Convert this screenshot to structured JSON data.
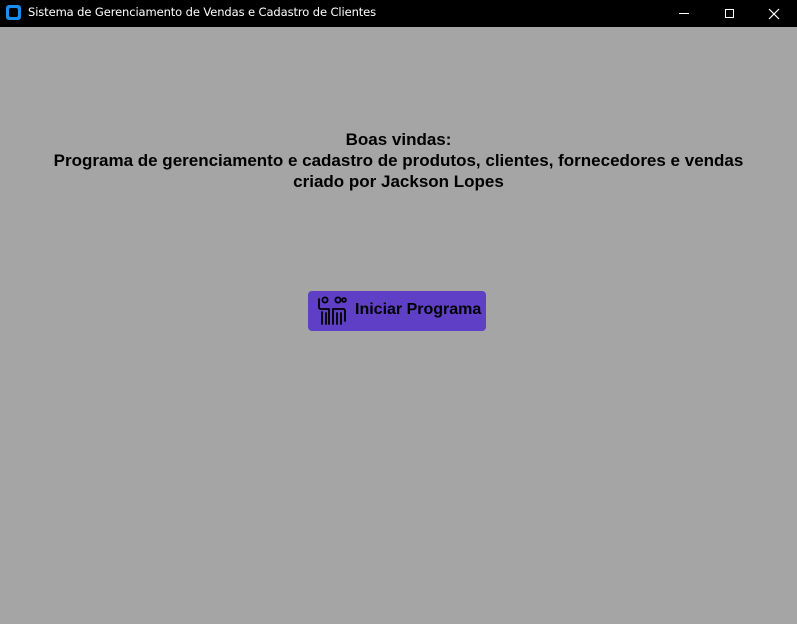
{
  "window": {
    "title": "Sistema de Gerenciamento de Vendas e Cadastro de Clientes",
    "app_icon": "app-window-icon",
    "controls": {
      "minimize": "minimize-icon",
      "maximize": "maximize-icon",
      "close": "close-icon"
    }
  },
  "main": {
    "welcome_line_1": "Boas vindas:",
    "welcome_line_2": "Programa de gerenciamento e cadastro de produtos, clientes, fornecedores e vendas",
    "welcome_line_3": "criado por Jackson Lopes",
    "start_button": {
      "label": "Iniciar Programa",
      "icon": "people-icon"
    }
  },
  "colors": {
    "background": "#a5a5a5",
    "titlebar": "#000000",
    "button": "#5e3fc6",
    "app_icon": "#1a8ef0"
  }
}
